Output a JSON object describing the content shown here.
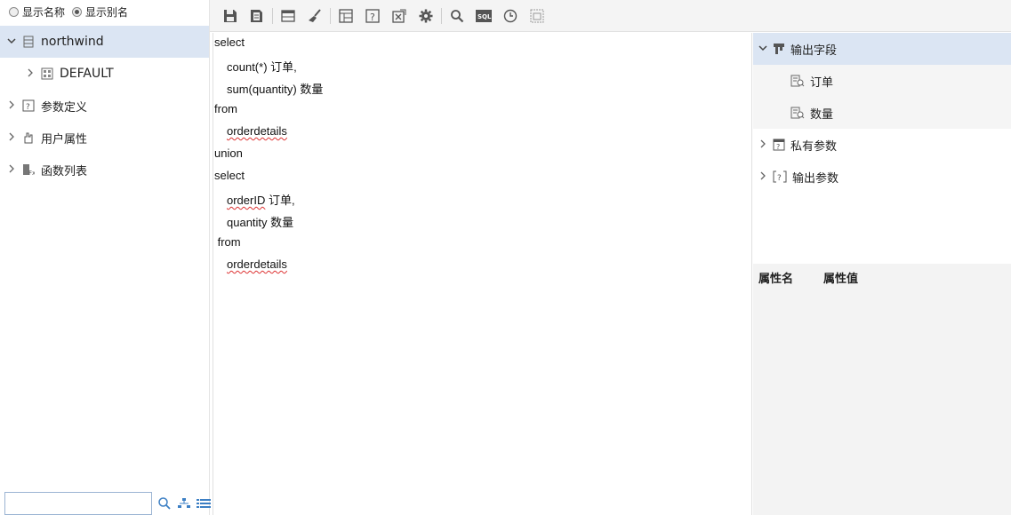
{
  "radio": {
    "option1": "显示名称",
    "option2": "显示别名",
    "selected": "option2"
  },
  "left_tree": {
    "datasource": "northwind",
    "schema": "DEFAULT",
    "items": [
      {
        "label": "参数定义",
        "icon": "param-icon"
      },
      {
        "label": "用户属性",
        "icon": "user-attr-icon"
      },
      {
        "label": "函数列表",
        "icon": "function-icon"
      }
    ]
  },
  "toolbar": {
    "buttons": [
      "save-icon",
      "save-as-icon",
      "table-icon",
      "brush-icon",
      "layout-icon",
      "param-query-icon",
      "export-icon",
      "gear-icon",
      "search-icon",
      "sql-icon",
      "clock-icon",
      "preview-icon"
    ]
  },
  "editor": {
    "lines": [
      {
        "indent": 0,
        "text": "select",
        "squiggle": false
      },
      {
        "indent": 1,
        "text": "count(*) 订单,",
        "squiggle": false
      },
      {
        "indent": 1,
        "text": "sum(quantity) 数量",
        "squiggle": false
      },
      {
        "indent": 0,
        "text": "from",
        "squiggle": false
      },
      {
        "indent": 1,
        "text": "orderdetails",
        "squiggle": true
      },
      {
        "indent": 0,
        "text": "union",
        "squiggle": false
      },
      {
        "indent": 0,
        "text": "select",
        "squiggle": false
      },
      {
        "indent": 1,
        "pre": "orderID",
        "text": " 订单,",
        "squiggle": true
      },
      {
        "indent": 1,
        "text": "quantity 数量",
        "squiggle": false
      },
      {
        "indent": 0,
        "text": " from",
        "squiggle": false
      },
      {
        "indent": 1,
        "text": "orderdetails",
        "squiggle": true
      }
    ]
  },
  "right_tree": {
    "output_fields": "输出字段",
    "fields": [
      "订单",
      "数量"
    ],
    "private_params": "私有参数",
    "output_params": "输出参数"
  },
  "props": {
    "name_header": "属性名",
    "value_header": "属性值"
  }
}
